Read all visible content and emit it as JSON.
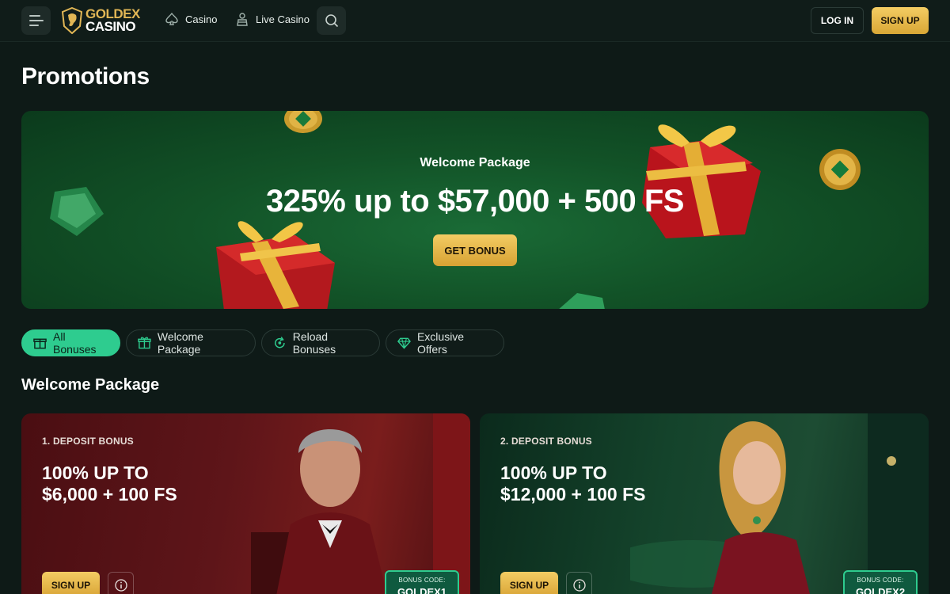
{
  "header": {
    "logo_line1": "GOLDEX",
    "logo_line2": "CASINO",
    "nav": [
      {
        "label": "Casino",
        "icon": "spade-icon"
      },
      {
        "label": "Live Casino",
        "icon": "dealer-icon"
      }
    ],
    "login_label": "LOG IN",
    "signup_label": "SIGN UP"
  },
  "page_title": "Promotions",
  "hero": {
    "subtitle": "Welcome Package",
    "title": "325% up to $57,000 + 500 FS",
    "button_label": "GET BONUS"
  },
  "filters": [
    {
      "label": "All Bonuses",
      "icon": "gift-icon",
      "active": true
    },
    {
      "label": "Welcome Package",
      "icon": "gift-box-icon",
      "active": false
    },
    {
      "label": "Reload Bonuses",
      "icon": "reload-icon",
      "active": false
    },
    {
      "label": "Exclusive Offers",
      "icon": "diamond-icon",
      "active": false
    }
  ],
  "section_title": "Welcome Package",
  "cards": [
    {
      "kicker": "1. DEPOSIT BONUS",
      "title_line1": "100% UP TO",
      "title_line2": "$6,000 + 100 FS",
      "signup_label": "SIGN UP",
      "code_label": "BONUS CODE:",
      "code_value": "GOLDEX1"
    },
    {
      "kicker": "2. DEPOSIT BONUS",
      "title_line1": "100% UP TO",
      "title_line2": "$12,000 + 100 FS",
      "signup_label": "SIGN UP",
      "code_label": "BONUS CODE:",
      "code_value": "GOLDEX2"
    }
  ],
  "colors": {
    "accent_green": "#2ecc8f",
    "gold": "#e1b655",
    "background": "#0e1a17"
  }
}
